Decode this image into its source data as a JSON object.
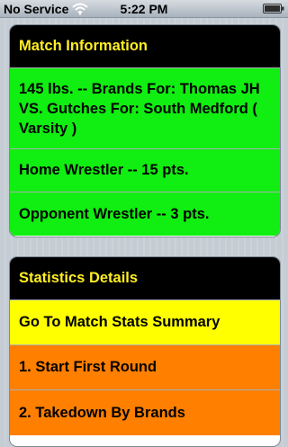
{
  "status_bar": {
    "carrier": "No Service",
    "time": "5:22 PM",
    "wifi_icon": "wifi-icon",
    "battery_icon": "battery-icon"
  },
  "colors": {
    "header_bg": "#000000",
    "header_text": "#ffee22",
    "green_cell": "#11ee11",
    "yellow_cell": "#ffff00",
    "orange_cell": "#ff7f00"
  },
  "match_information": {
    "header": "Match Information",
    "match_desc": "145 lbs. -- Brands For: Thomas JH VS. Gutches For: South Medford ( Varsity )",
    "home_wrestler": "Home Wrestler -- 15 pts.",
    "opponent_wrestler": "Opponent Wrestler -- 3 pts."
  },
  "statistics_details": {
    "header": "Statistics Details",
    "items": [
      {
        "label": "Go To Match Stats Summary"
      },
      {
        "label": "1.  Start First Round"
      },
      {
        "label": "2.  Takedown By Brands"
      }
    ]
  }
}
